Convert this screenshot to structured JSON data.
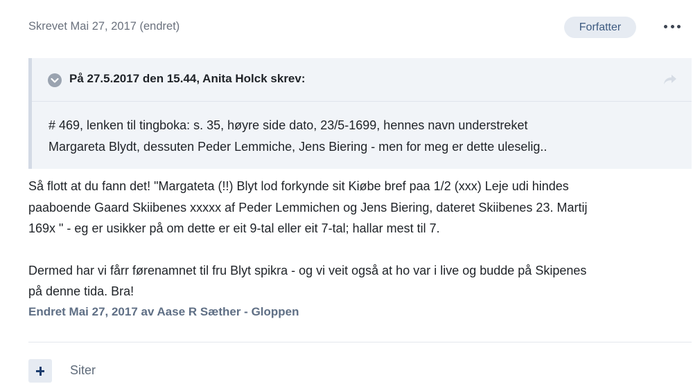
{
  "post_meta": {
    "posted_text": "Skrevet Mai 27, 2017 (endret)",
    "author_badge": "Forfatter",
    "more_icon": "ellipsis-icon"
  },
  "quote": {
    "title": "På 27.5.2017 den 15.44, Anita Holck skrev:",
    "collapse_icon": "chevron-down-icon",
    "share_icon": "share-arrow-icon",
    "lines": [
      "# 469, lenken til tingboka: s. 35, høyre side dato, 23/5-1699, hennes navn understreket",
      "Margareta Blydt, dessuten Peder Lemmiche, Jens Biering - men for meg er dette uleselig.."
    ]
  },
  "post": {
    "paragraph1_lines": [
      "Så flott at du fann det!  \"Margateta (!!) Blyt lod forkynde sit Kiøbe bref paa 1/2 (xxx) Leje udi hindes",
      "paaboende Gaard Skiibenes xxxxx af Peder Lemmichen og Jens Biering, dateret Skiibenes 23. Martij",
      "169x \" - eg er usikker på om dette er eit 9-tal eller eit 7-tal; hallar mest til 7."
    ],
    "paragraph2_lines": [
      "Dermed har vi fårr førenamnet til fru Blyt spikra - og vi veit også at ho var i live og budde på Skipenes",
      "på denne tida. Bra!"
    ],
    "edited_text": "Endret Mai 27, 2017 av Aase R Sæther - Gloppen"
  },
  "actions": {
    "multiquote_icon": "plus-icon",
    "quote_label": "Siter"
  }
}
